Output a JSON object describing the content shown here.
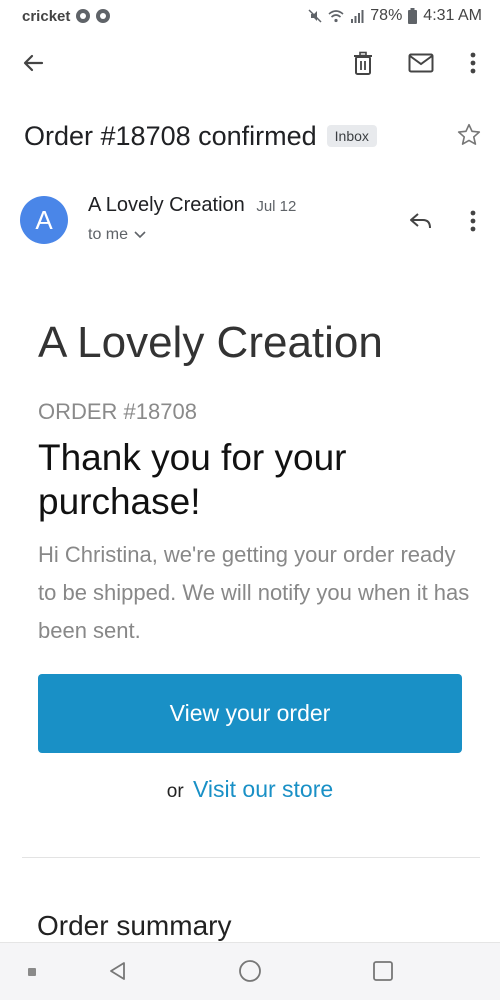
{
  "status_bar": {
    "carrier": "cricket",
    "battery": "78%",
    "time": "4:31 AM"
  },
  "toolbar": {
    "back_icon": "arrow-left-icon",
    "delete_icon": "trash-icon",
    "mark_unread_icon": "mail-icon",
    "more_icon": "more-vert-icon"
  },
  "email": {
    "subject": "Order #18708 confirmed",
    "label": "Inbox",
    "sender_initial": "A",
    "sender_name": "A Lovely Creation",
    "date": "Jul 12",
    "recipient": "to me"
  },
  "message": {
    "store_name": "A Lovely Creation",
    "order_number": "ORDER #18708",
    "headline": "Thank you for your purchase!",
    "body": "Hi Christina, we're getting your order ready to be shipped. We will notify you when it has been sent.",
    "cta_label": "View your order",
    "alt_prefix": "or",
    "alt_link": "Visit our store",
    "summary_heading": "Order summary"
  },
  "colors": {
    "accent": "#1990c6",
    "avatar": "#4a86e8"
  }
}
